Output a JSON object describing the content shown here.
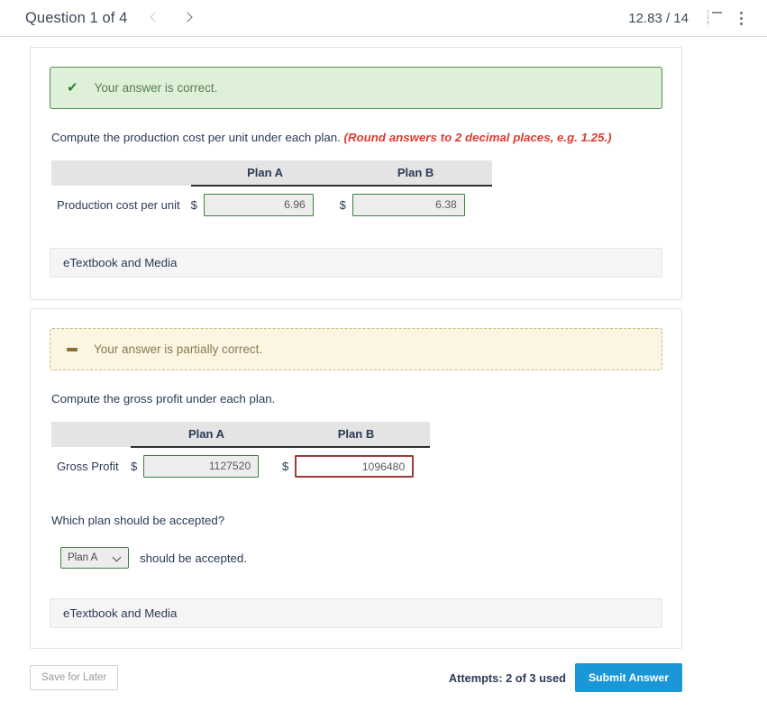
{
  "header": {
    "question_label": "Question 1 of 4",
    "prev_icon": "chevron-left-icon",
    "next_icon": "chevron-right-icon",
    "score": "12.83 / 14",
    "list_icon": "numbered-list-icon",
    "menu_icon": "kebab-menu-icon"
  },
  "cards": [
    {
      "banner": {
        "status": "correct",
        "icon": "check-icon",
        "text": "Your answer is correct."
      },
      "prompt": "Compute the production cost per unit under each plan.",
      "hint": "(Round answers to 2 decimal places, e.g. 1.25.)",
      "table": {
        "columns": [
          "",
          "Plan A",
          "Plan B"
        ],
        "rows": [
          {
            "label": "Production cost per unit",
            "cells": [
              {
                "currency": "$",
                "value": "6.96",
                "state": "correct"
              },
              {
                "currency": "$",
                "value": "6.38",
                "state": "correct"
              }
            ]
          }
        ]
      },
      "etextbook_label": "eTextbook and Media"
    },
    {
      "banner": {
        "status": "partial",
        "icon": "dash-icon",
        "text": "Your answer is partially correct."
      },
      "prompt": "Compute the gross profit under each plan.",
      "hint": "",
      "table": {
        "columns": [
          "",
          "Plan A",
          "Plan B"
        ],
        "rows": [
          {
            "label": "Gross Profit",
            "cells": [
              {
                "currency": "$",
                "value": "1127520",
                "state": "correct"
              },
              {
                "currency": "$",
                "value": "1096480",
                "state": "incorrect"
              }
            ]
          }
        ]
      },
      "subquestion": {
        "prompt": "Which plan should be accepted?",
        "select_value": "Plan A",
        "select_caret": "chevron-down-icon",
        "suffix": "should be accepted."
      },
      "etextbook_label": "eTextbook and Media"
    }
  ],
  "footer": {
    "save_label": "Save for Later",
    "attempts": "Attempts: 2 of 3 used",
    "submit_label": "Submit Answer"
  },
  "colors": {
    "correct_border": "#4a934a",
    "correct_bg": "#dff0d8",
    "partial_bg": "#fcf5e2",
    "partial_border": "#c9b98a",
    "incorrect_border": "#9e3b3b",
    "hint_red": "#e03a2f",
    "submit_blue": "#1a97d9"
  }
}
